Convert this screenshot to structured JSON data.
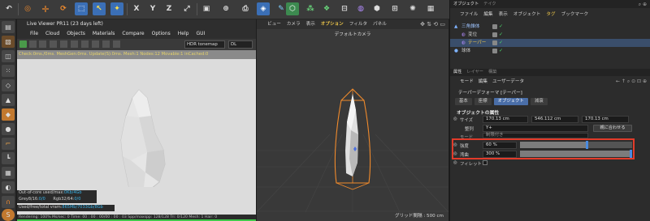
{
  "top_toolbar": {
    "icons": [
      "undo-icon",
      "render-region-icon",
      "move-icon",
      "rotate-icon",
      "scale-icon",
      "select-icon",
      "x-axis-icon",
      "y-axis-icon",
      "z-axis-icon",
      "world-icon",
      "camera-icon",
      "cube-icon",
      "pen-icon",
      "spline-icon",
      "subdivision-icon",
      "cloner-icon",
      "boolean-icon",
      "deformer-icon",
      "light-icon"
    ],
    "axis_labels": [
      "X",
      "Y",
      "Z"
    ]
  },
  "live_viewer": {
    "title": "Live Viewer PR11 (23 days left)",
    "menu": [
      "File",
      "Cloud",
      "Objects",
      "Materials",
      "Compare",
      "Options",
      "Help",
      "GUI"
    ],
    "tonemap": "HDR tonemap",
    "mode": "DL",
    "status_text": "Check:0ms./0ms. MeshGen:0ms. Update(S):0ms. Mesh:1 Nodes:12 Movable:1 inCached:0",
    "info": {
      "out_of_core_label": "Out-of-core used/max:",
      "out_of_core_value": "0Kb/4Gb",
      "grey_label": "Grey8/16:",
      "grey_value": "0/0",
      "rgb_label": "Rgb32/64:",
      "rgb_value": "0/0",
      "vram_label": "Used/free/total vram:",
      "vram_value": "865Mb/7033Gb/8Gb"
    },
    "footer": "Rendering: 100%   Ms/sec: 0   Time: 00 : 00 : 00/00 : 00 : 03   Spp/maxspp: 128/128   Tri: 0/120   Mesh: 1   Hair: 0"
  },
  "viewport": {
    "menu": [
      "ビュー",
      "カメラ",
      "表示",
      "オプション",
      "フィルタ",
      "パネル"
    ],
    "active_menu_index": 3,
    "camera_label": "デフォルトカメラ",
    "grid_spacing": "グリッド間隔 : 500 cm"
  },
  "object_manager": {
    "tabs": [
      "オブジェクト",
      "テイク"
    ],
    "menu": [
      "ファイル",
      "編集",
      "表示",
      "オブジェクト",
      "タグ",
      "ブックマーク"
    ],
    "active_menu_index": 4,
    "objects": [
      {
        "name": "三角錐体",
        "indent": 0
      },
      {
        "name": "変位",
        "indent": 1
      },
      {
        "name": "テーパー",
        "indent": 1
      },
      {
        "name": "球体",
        "indent": 0
      }
    ],
    "selected_index": 2
  },
  "attributes": {
    "tabs": [
      "属性",
      "レイヤー",
      "構築"
    ],
    "menu": [
      "モード",
      "編集",
      "ユーザーデータ"
    ],
    "object_title": "テーパーデフォーマ [テーパー]",
    "subtabs": [
      "基本",
      "座標",
      "オブジェクト",
      "減衰"
    ],
    "active_subtab_index": 2,
    "section_title": "オブジェクトの属性",
    "size_label": "サイズ",
    "size_values": [
      "170.13 cm",
      "546.112 cm",
      "170.13 cm"
    ],
    "align_label": "整列",
    "align_value": "Y+",
    "fit_button": "親に合わせる",
    "mode_label": "モード",
    "mode_value": "制限付き",
    "strength_label": "強度",
    "strength_value": "60 %",
    "strength_fraction": 0.6,
    "curvature_label": "湾曲",
    "curvature_value": "300 %",
    "curvature_fraction": 1.0,
    "fillet_label": "フィレット"
  },
  "colors": {
    "accent_blue": "#4a6ea8",
    "highlight_red": "#e23b2a",
    "active_yellow": "#f0c84a",
    "check_green": "#4bd96b",
    "deformer_orange": "#f08a2c"
  }
}
